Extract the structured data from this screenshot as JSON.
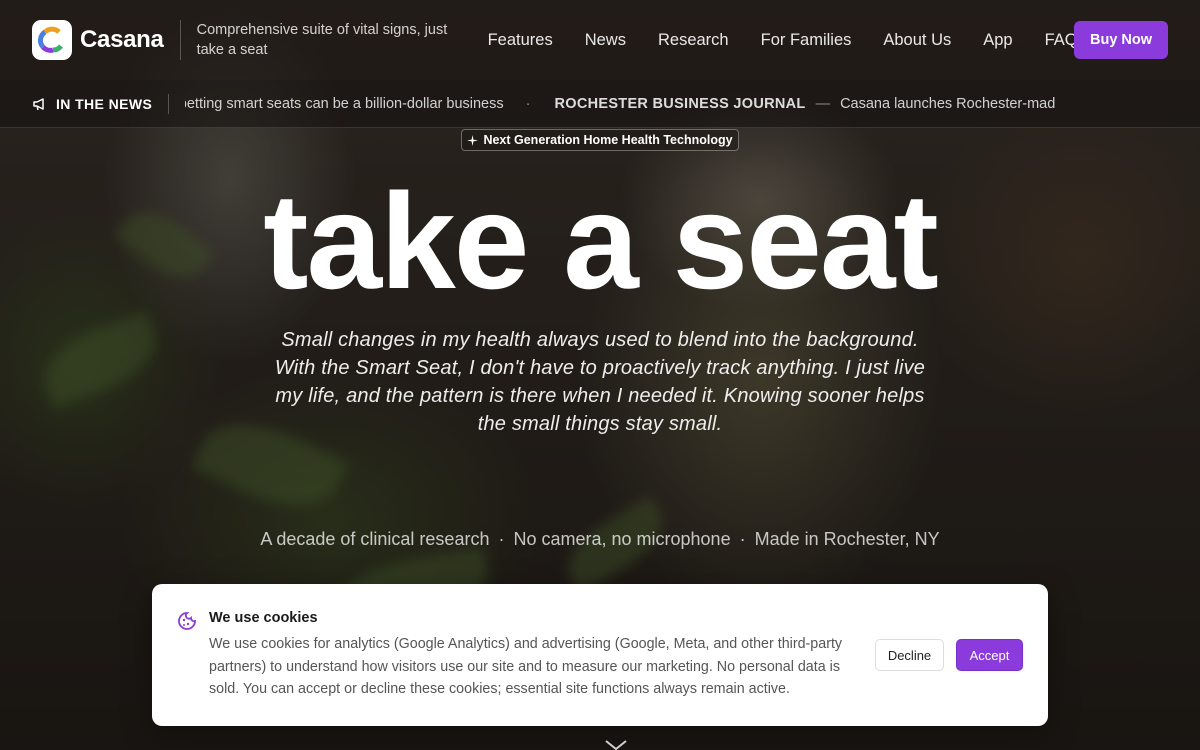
{
  "header": {
    "brand": "Casana",
    "tagline": "Comprehensive suite of vital signs, just take a seat",
    "nav": [
      "Features",
      "News",
      "Research",
      "For Families",
      "About Us",
      "App",
      "FAQ"
    ],
    "cta": "Buy Now",
    "accent_color": "#8b3bdc"
  },
  "ticker": {
    "label": "IN THE NEWS",
    "icon": "megaphone-icon",
    "headline_1": "M toilet startup is betting smart seats can be a billion-dollar business",
    "separator": "·",
    "outlet_2": "ROCHESTER BUSINESS JOURNAL",
    "dash": "—",
    "headline_2": "Casana launches Rochester-mad"
  },
  "hero": {
    "badge": "Next Generation Home Health Technology",
    "badge_icon": "sparkle-icon",
    "title": "take a seat",
    "quote": "Small changes in my health always used to blend into the background. With the Smart Seat, I don't have to proactively track anything. I just live my life, and the pattern is there when I needed it. Knowing sooner helps the small things stay small.",
    "facts": [
      "A decade of clinical research",
      "No camera, no microphone",
      "Made in Rochester, NY"
    ],
    "fact_separator": "·",
    "scroll_icon": "chevron-down-icon"
  },
  "cookie_banner": {
    "icon": "cookie-icon",
    "title": "We use cookies",
    "body": "We use cookies for analytics (Google Analytics) and advertising (Google, Meta, and other third-party partners) to understand how visitors use our site and to measure our marketing. No personal data is sold. You can accept or decline these cookies; essential site functions always remain active.",
    "decline_label": "Decline",
    "accept_label": "Accept"
  }
}
